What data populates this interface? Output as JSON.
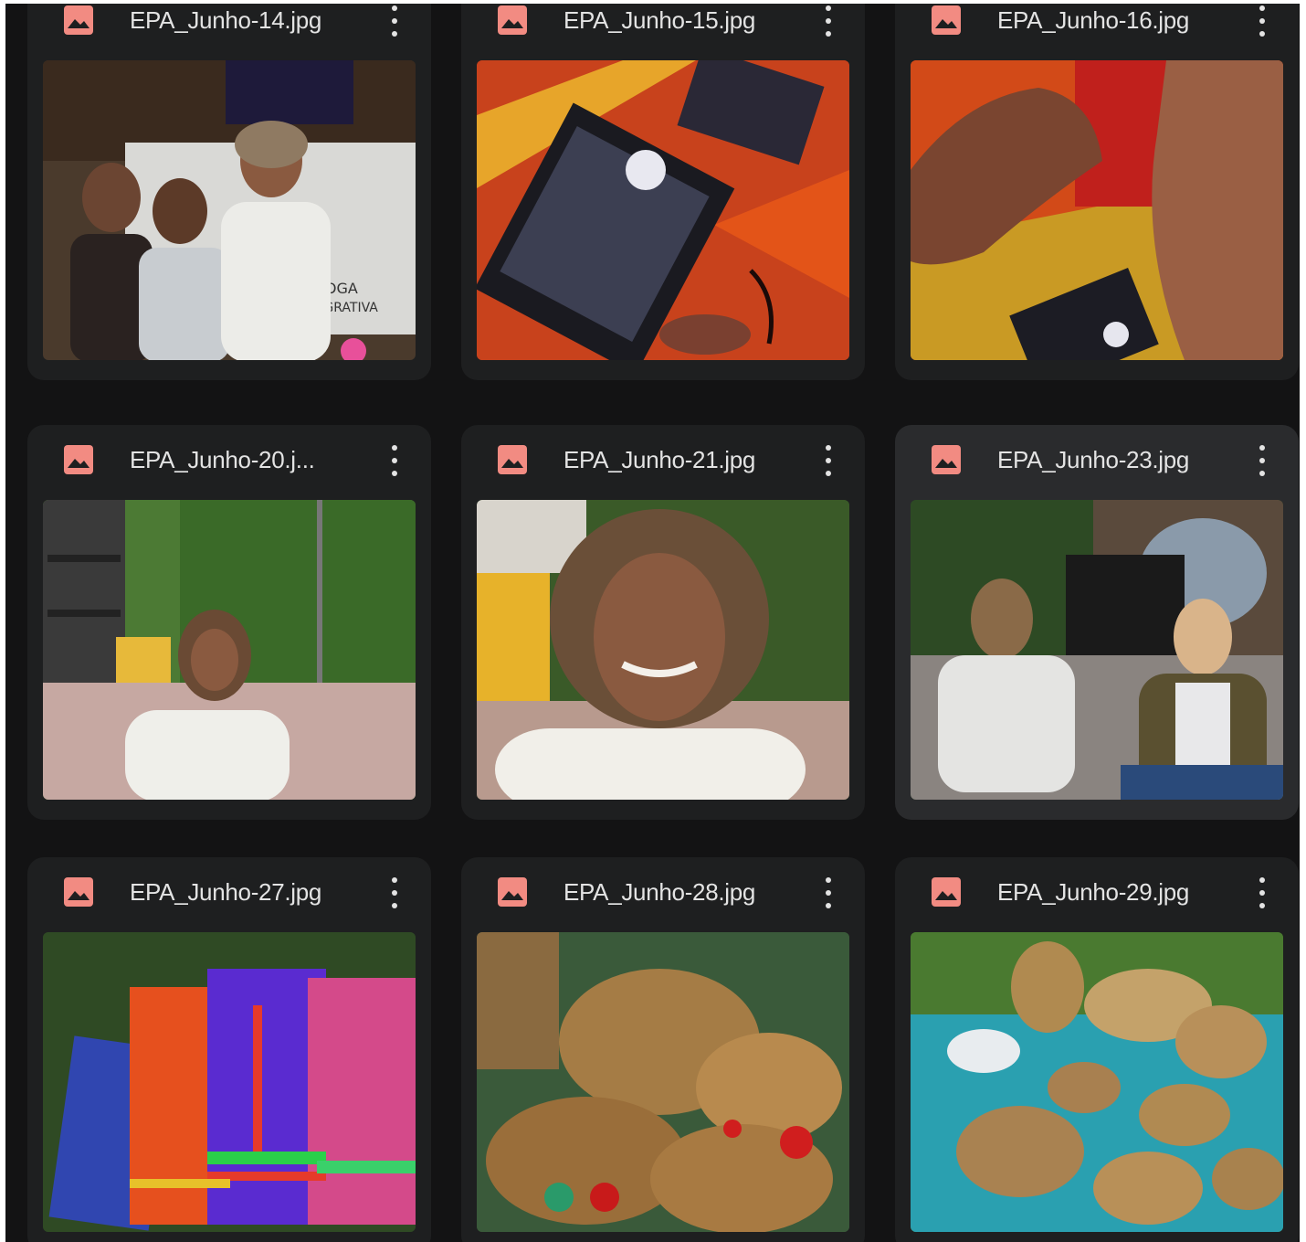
{
  "files": [
    {
      "name": "EPA_Junho-14.jpg",
      "thumbnail": "three women smiling in front of yoga banner"
    },
    {
      "name": "EPA_Junho-15.jpg",
      "thumbnail": "tarot cards on red patterned cloth"
    },
    {
      "name": "EPA_Junho-16.jpg",
      "thumbnail": "hands holding cards over red cloth"
    },
    {
      "name": "EPA_Junho-20.j...",
      "thumbnail": "smiling woman with curly hair in garden"
    },
    {
      "name": "EPA_Junho-21.jpg",
      "thumbnail": "close-up portrait of smiling woman"
    },
    {
      "name": "EPA_Junho-23.jpg",
      "thumbnail": "two women meditating outdoors"
    },
    {
      "name": "EPA_Junho-27.jpg",
      "thumbnail": "colorful skirts hanging outdoors"
    },
    {
      "name": "EPA_Junho-28.jpg",
      "thumbnail": "woven straw baskets with red flowers"
    },
    {
      "name": "EPA_Junho-29.jpg",
      "thumbnail": "woven baskets on blue cloth"
    }
  ],
  "icons": {
    "file_type": "image-file-icon",
    "more": "more-vert-icon"
  },
  "colors": {
    "background": "#131314",
    "card": "#1e1f20",
    "card_hover": "#2a2b2d",
    "image_icon": "#f28b82",
    "text": "#e3e3e3"
  }
}
